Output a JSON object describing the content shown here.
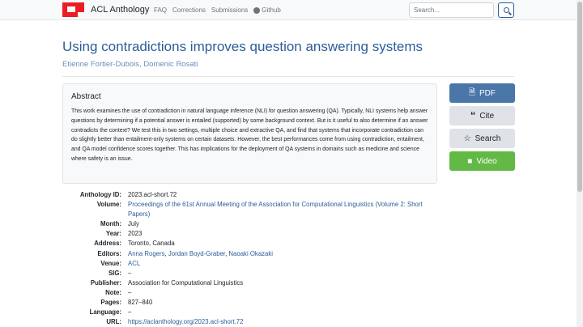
{
  "navbar": {
    "brand": "ACL Anthology",
    "links": [
      "FAQ",
      "Corrections",
      "Submissions",
      "Github"
    ],
    "search_placeholder": "Search..."
  },
  "paper": {
    "title": "Using contradictions improves question answering systems",
    "authors": "Etienne Fortier-Dubois, Domenic Rosati"
  },
  "abstract": {
    "heading": "Abstract",
    "text": "This work examines the use of contradiction in natural language inference (NLI) for question answering (QA). Typically, NLI systems help answer questions by determining if a potential answer is entailed (supported) by some background context. But is it useful to also determine if an answer contradicts the context? We test this in two settings, multiple choice and extractive QA, and find that systems that incorporate contradiction can do slightly better than entailment-only systems on certain datasets. However, the best performances come from using contradiction, entailment, and QA model confidence scores together. This has implications for the deployment of QA systems in domains such as medicine and science where safety is an issue."
  },
  "buttons": {
    "pdf": "PDF",
    "cite": "Cite",
    "search": "Search",
    "video": "Video"
  },
  "metadata": {
    "anthology_id_label": "Anthology ID:",
    "anthology_id": "2023.acl-short.72",
    "volume_label": "Volume:",
    "volume": "Proceedings of the 61st Annual Meeting of the Association for Computational Linguistics (Volume 2: Short Papers)",
    "month_label": "Month:",
    "month": "July",
    "year_label": "Year:",
    "year": "2023",
    "address_label": "Address:",
    "address": "Toronto, Canada",
    "editors_label": "Editors:",
    "editor_1": "Anna Rogers",
    "editor_2": "Jordan Boyd-Graber",
    "editor_3": "Naoaki Okazaki",
    "venue_label": "Venue:",
    "venue": "ACL",
    "sig_label": "SIG:",
    "sig": "–",
    "publisher_label": "Publisher:",
    "publisher": "Association for Computational Linguistics",
    "note_label": "Note:",
    "note": "–",
    "pages_label": "Pages:",
    "pages": "827–840",
    "language_label": "Language:",
    "language": "–",
    "url_label": "URL:",
    "url": "https://aclanthology.org/2023.acl-short.72"
  },
  "colors": {
    "link": "#2b5d9a",
    "pdf_button": "#4a76a8",
    "video_button": "#62b945",
    "logo": "#ed1c24"
  }
}
